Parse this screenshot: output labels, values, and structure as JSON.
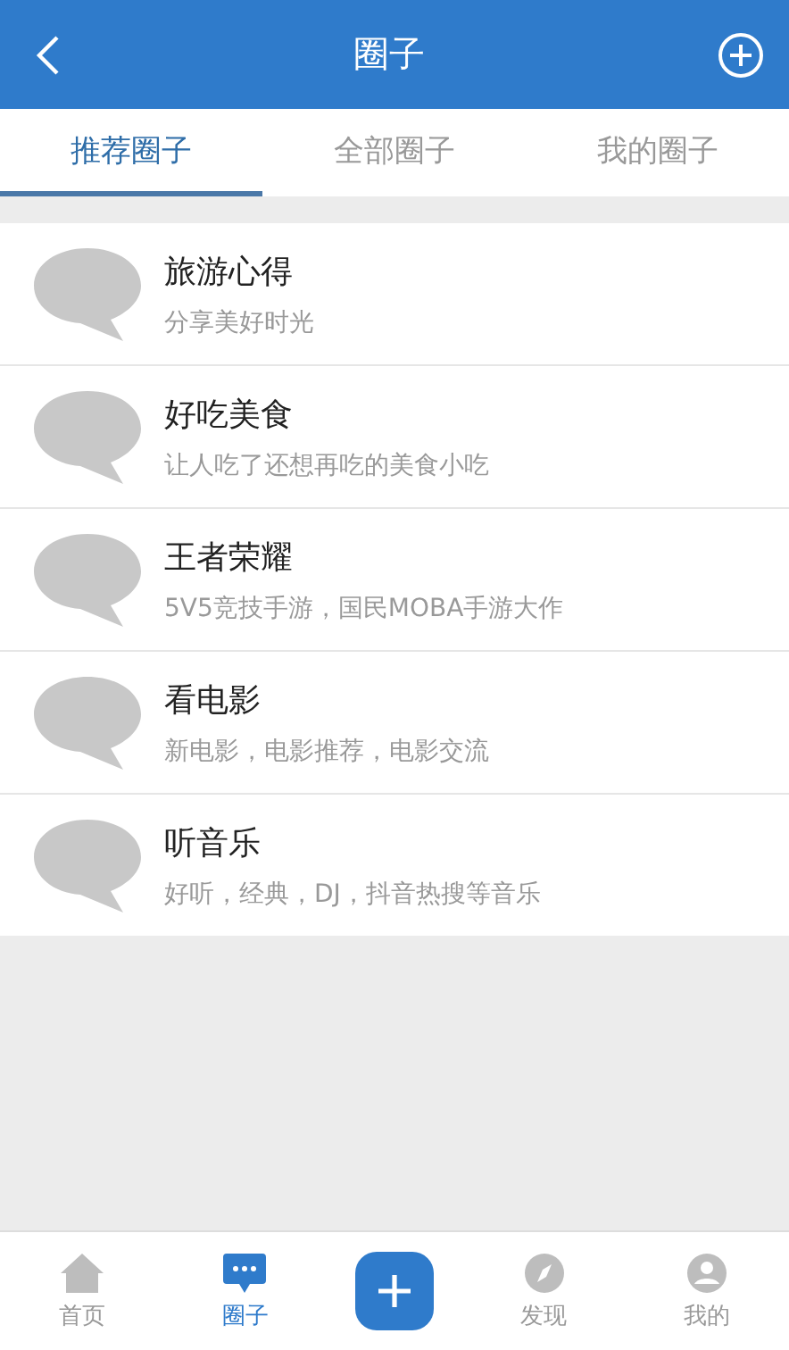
{
  "header": {
    "title": "圈子"
  },
  "tabs": [
    {
      "label": "推荐圈子",
      "selected": true
    },
    {
      "label": "全部圈子",
      "selected": false
    },
    {
      "label": "我的圈子",
      "selected": false
    }
  ],
  "circles": [
    {
      "name": "旅游心得",
      "description": "分享美好时光"
    },
    {
      "name": "好吃美食",
      "description": "让人吃了还想再吃的美食小吃"
    },
    {
      "name": "王者荣耀",
      "description": "5V5竞技手游，国民MOBA手游大作"
    },
    {
      "name": "看电影",
      "description": "新电影，电影推荐，电影交流"
    },
    {
      "name": "听音乐",
      "description": "好听，经典，DJ，抖音热搜等音乐"
    }
  ],
  "bottom_nav": [
    {
      "kind": "home",
      "label": "首页",
      "selected": false
    },
    {
      "kind": "circle",
      "label": "圈子",
      "selected": true
    },
    {
      "kind": "add"
    },
    {
      "kind": "discover",
      "label": "发现",
      "selected": false
    },
    {
      "kind": "mine",
      "label": "我的",
      "selected": false
    }
  ]
}
